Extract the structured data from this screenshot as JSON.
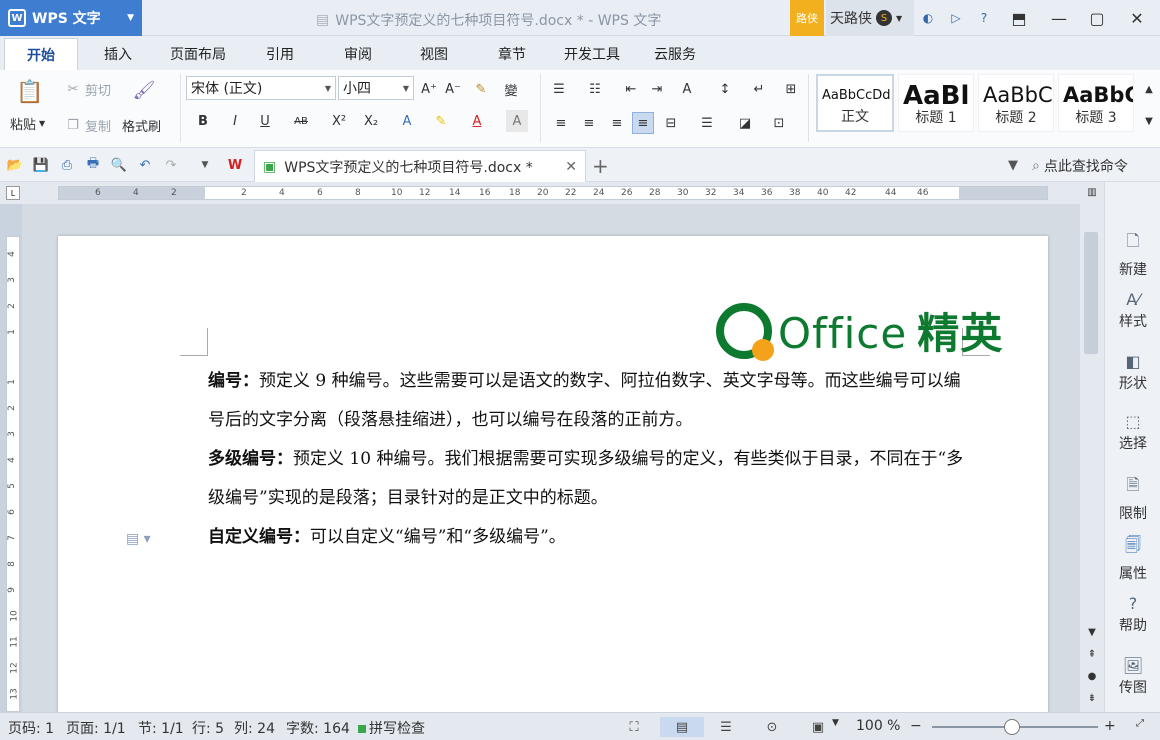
{
  "app": {
    "name": "WPS 文字",
    "logo": "W"
  },
  "window": {
    "title": "WPS文字预定义的七种项目符号.docx * - WPS 文字"
  },
  "user": {
    "badge": "路侠",
    "name": "天路侠",
    "coin": "S"
  },
  "menu_tabs": [
    "开始",
    "插入",
    "页面布局",
    "引用",
    "审阅",
    "视图",
    "章节",
    "开发工具",
    "云服务"
  ],
  "clipboard": {
    "paste": "粘贴",
    "cut": "剪切",
    "copy": "复制",
    "format_painter": "格式刷"
  },
  "font": {
    "name": "宋体 (正文)",
    "size": "小四"
  },
  "styles": [
    {
      "sample": "AaBbCcDd",
      "name": "正文"
    },
    {
      "sample": "AaBl",
      "name": "标题 1"
    },
    {
      "sample": "AaBbC",
      "name": "标题 2"
    },
    {
      "sample": "AaBbC",
      "name": "标题 3"
    }
  ],
  "doc_tab": {
    "label": "WPS文字预定义的七种项目符号.docx *"
  },
  "find_command": "点此查找命令",
  "ruler_ticks": [
    "6",
    "4",
    "2",
    "2",
    "4",
    "6",
    "8",
    "10",
    "12",
    "14",
    "16",
    "18",
    "20",
    "22",
    "24",
    "26",
    "28",
    "30",
    "32",
    "34",
    "36",
    "38",
    "40",
    "42",
    "44",
    "46"
  ],
  "vruler_ticks": [
    "4",
    "3",
    "2",
    "1",
    "1",
    "2",
    "3",
    "4",
    "5",
    "6",
    "7",
    "8",
    "9",
    "10",
    "11",
    "12",
    "13"
  ],
  "logo_text": {
    "office": "Office",
    "jingying": "精英"
  },
  "document": {
    "p1_label": "编号：",
    "p1_text": "预定义 9 种编号。这些需要可以是语文的数字、阿拉伯数字、英文字母等。而这些编号可以编号后的文字分离（段落悬挂缩进），也可以编号在段落的正前方。",
    "p2_label": "多级编号：",
    "p2_text": "预定义 10 种编号。我们根据需要可实现多级编号的定义，有些类似于目录，不同在于“多级编号”实现的是段落；目录针对的是正文中的标题。",
    "p3_label": "自定义编号：",
    "p3_text": "可以自定义“编号”和“多级编号”。"
  },
  "side_panel": [
    "新建",
    "样式",
    "形状",
    "选择",
    "限制",
    "属性",
    "帮助",
    "传图"
  ],
  "status": {
    "page_no": "页码: 1",
    "pages": "页面: 1/1",
    "section": "节: 1/1",
    "row": "行: 5",
    "col": "列: 24",
    "word_count": "字数: 164",
    "spell_check": "拼写检查",
    "zoom": "100 %"
  },
  "colors": {
    "accent": "#3f7dd1",
    "logo_green": "#0e7a30",
    "logo_orange": "#f5a21b",
    "badge": "#f2b01e"
  }
}
